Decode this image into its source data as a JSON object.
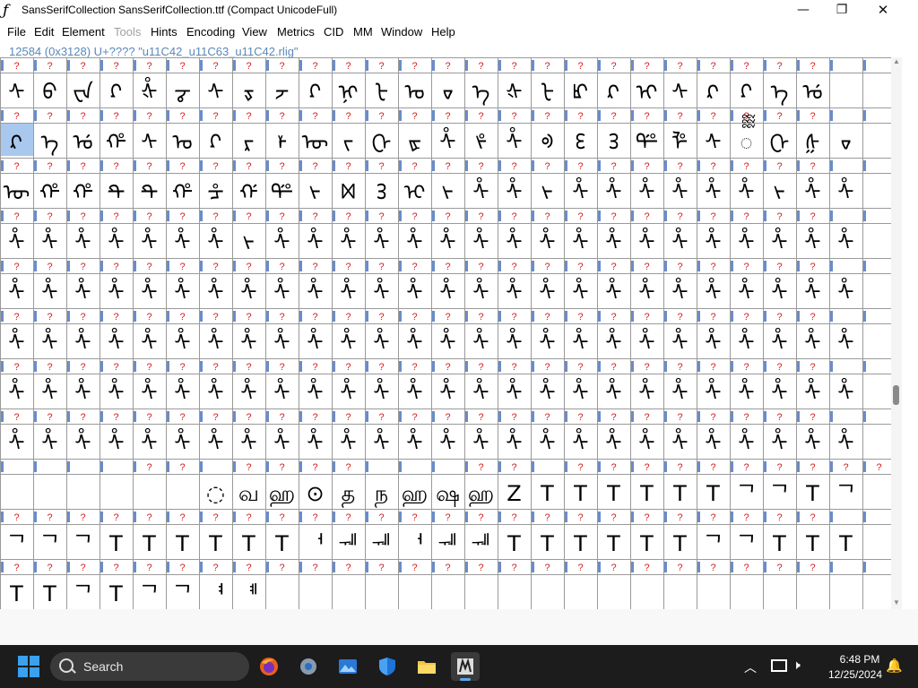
{
  "window": {
    "title": "SansSerifCollection  SansSerifCollection.ttf (Compact UnicodeFull)",
    "app_icon": "fontforge-icon",
    "controls": {
      "minimize": "—",
      "maximize": "❐",
      "close": "✕"
    }
  },
  "menu": [
    {
      "label": "File",
      "enabled": true
    },
    {
      "label": "Edit",
      "enabled": true
    },
    {
      "label": "Element",
      "enabled": true
    },
    {
      "label": "Tools",
      "enabled": false
    },
    {
      "label": "Hints",
      "enabled": true
    },
    {
      "label": "Encoding",
      "enabled": true
    },
    {
      "label": "View",
      "enabled": true
    },
    {
      "label": "Metrics",
      "enabled": true
    },
    {
      "label": "CID",
      "enabled": true
    },
    {
      "label": "MM",
      "enabled": true
    },
    {
      "label": "Window",
      "enabled": true
    },
    {
      "label": "Help",
      "enabled": true
    }
  ],
  "status_line": "12584 (0x3128) U+???? \"u11C42_u11C63_u11C42.rlig\"",
  "grid": {
    "columns": 27,
    "cell_label": "?",
    "row_label_colors": {
      "question": "#d42020",
      "unicode_box": "#4a4a4a",
      "marker": "#6a8cc8",
      "selected_bg": "#a8c8ee"
    },
    "rows": [
      {
        "labels": "?????????????????????????",
        "glyphs": [
          "ᠰ",
          "ᠪ",
          "ᠸᠠ",
          "ᡗ",
          "ᢤ",
          "ᡒ",
          "ᠰ",
          "ᢌ",
          "ᡔ",
          "ᡗ",
          "ᢊ",
          "ᡶ",
          "ᠣ",
          "ᢦ",
          "ᡝ",
          "ᡧ",
          "ᡶ",
          "ᡌ",
          "ᡘ",
          "ᡞ",
          "ᠰ",
          "ᡘ",
          "ᡗ",
          "ᡝ",
          "ᡠ",
          "",
          ""
        ]
      },
      {
        "labels": "?????????????????????????",
        "glyphs": [
          "ᡘ",
          "ᡝ",
          "ᡠ",
          "ᡥ",
          "ᠰ",
          "ᠣ",
          "ᡗ",
          "ᡵ",
          "ᡟ",
          "ᡡ",
          "ᡪ",
          "ᢕ",
          "ᢘ",
          "ᢥ",
          "ᢞ",
          "ᢥ",
          "ᢀ",
          "ᢄ",
          "ᢃ",
          "ᢡ",
          "ᢪ",
          "ᠰ",
          "ᢆ",
          "ᢕ",
          "ᢔ",
          "ᢦ",
          ""
        ]
      },
      {
        "labels": "?????????????????????????",
        "glyphs": [
          "ᡡ",
          "ᡥ",
          "ᡥ",
          "ᡨ",
          "ᡨ",
          "ᡥ",
          "ᡱ",
          "ᡤ",
          "ᢡ",
          "ᢣ",
          "ᢂ",
          "ᢃ",
          "ᢈ",
          "ᢣ",
          "ᢥ",
          "ᢥ",
          "ᢣ",
          "ᢥ",
          "ᢥ",
          "ᢥ",
          "ᢥ",
          "ᢥ",
          "ᢥ",
          "ᢣ",
          "ᢥ",
          "ᢥ",
          ""
        ]
      },
      {
        "labels": "?????????????????????????",
        "glyphs": [
          "ᢥ",
          "ᢥ",
          "ᢥ",
          "ᢥ",
          "ᢥ",
          "ᢥ",
          "ᢥ",
          "ᢣ",
          "ᢥ",
          "ᢥ",
          "ᢥ",
          "ᢥ",
          "ᢥ",
          "ᢥ",
          "ᢥ",
          "ᢥ",
          "ᢥ",
          "ᢥ",
          "ᢥ",
          "ᢥ",
          "ᢥ",
          "ᢥ",
          "ᢥ",
          "ᢥ",
          "ᢥ",
          "ᢥ",
          ""
        ]
      },
      {
        "labels": "?????????????????????????",
        "glyphs": [
          "ᢥ",
          "ᢥ",
          "ᢥ",
          "ᢥ",
          "ᢥ",
          "ᢥ",
          "ᢥ",
          "ᢥ",
          "ᢥ",
          "ᢥ",
          "ᢥ",
          "ᢥ",
          "ᢥ",
          "ᢥ",
          "ᢥ",
          "ᢥ",
          "ᢥ",
          "ᢥ",
          "ᢥ",
          "ᢥ",
          "ᢥ",
          "ᢥ",
          "ᢥ",
          "ᢥ",
          "ᢥ",
          "ᢥ",
          ""
        ]
      },
      {
        "labels": "?????????????????????????",
        "glyphs": [
          "ᢥ",
          "ᢥ",
          "ᢥ",
          "ᢥ",
          "ᢥ",
          "ᢥ",
          "ᢥ",
          "ᢥ",
          "ᢥ",
          "ᢥ",
          "ᢥ",
          "ᢥ",
          "ᢥ",
          "ᢥ",
          "ᢥ",
          "ᢥ",
          "ᢥ",
          "ᢥ",
          "ᢥ",
          "ᢥ",
          "ᢥ",
          "ᢥ",
          "ᢥ",
          "ᢥ",
          "ᢥ",
          "ᢥ",
          ""
        ]
      },
      {
        "labels": "?????????????????????????",
        "glyphs": [
          "ᢥ",
          "ᢥ",
          "ᢥ",
          "ᢥ",
          "ᢥ",
          "ᢥ",
          "ᢥ",
          "ᢥ",
          "ᢥ",
          "ᢥ",
          "ᢥ",
          "ᢥ",
          "ᢥ",
          "ᢥ",
          "ᢥ",
          "ᢥ",
          "ᢥ",
          "ᢥ",
          "ᢥ",
          "ᢥ",
          "ᢥ",
          "ᢥ",
          "ᢥ",
          "ᢥ",
          "ᢥ",
          "ᢥ",
          ""
        ]
      },
      {
        "labels": "?????????????????????????",
        "glyphs": [
          "ᢥ",
          "ᢥ",
          "ᢥ",
          "ᢥ",
          "ᢥ",
          "ᢥ",
          "ᢥ",
          "ᢥ",
          "ᢥ",
          "ᢥ",
          "ᢥ",
          "ᢥ",
          "ᢥ",
          "ᢥ",
          "ᢥ",
          "ᢥ",
          "ᢥ",
          "ᢥ",
          "ᢥ",
          "ᢥ",
          "ᢥ",
          "ᢥ",
          "ᢥ",
          "ᢥ",
          "ᢥ",
          "ᢥ",
          ""
        ]
      },
      {
        "labels": "    ?? ????   ?? ??????????",
        "glyphs": [
          "",
          "",
          "",
          "",
          "",
          "",
          "◌",
          "வ",
          "ஹ",
          "⊙",
          "த",
          "ந",
          "ஹ",
          "ஷ",
          "ஹ",
          "Z",
          "T",
          "T",
          "T",
          "T",
          "T",
          "T",
          "ᄀ",
          "ᄀ",
          "T",
          "ᄀ",
          ""
        ]
      },
      {
        "labels": "?????????????????????????",
        "glyphs": [
          "ᄀ",
          "ᄀ",
          "ᄀ",
          "T",
          "T",
          "T",
          "T",
          "T",
          "T",
          "ᅥ",
          "ᅰ",
          "ᅰ",
          "ᅥ",
          "ᅰ",
          "ᅰ",
          "T",
          "T",
          "T",
          "T",
          "T",
          "T",
          "ᄀ",
          "ᄀ",
          "T",
          "T",
          "T",
          ""
        ]
      },
      {
        "labels": "?????????????????????????",
        "glyphs": [
          "T",
          "T",
          "ᄀ",
          "T",
          "ᄀ",
          "ᄀ",
          "ᅧ",
          "ᅨ",
          "",
          "",
          "",
          "",
          "",
          "",
          "",
          "",
          "",
          "",
          "",
          "",
          "",
          "",
          "",
          "",
          "",
          "",
          ""
        ]
      }
    ]
  },
  "taskbar": {
    "search_label": "Search",
    "apps": [
      "firefox-icon",
      "settings-icon",
      "photos-icon",
      "security-icon",
      "file-explorer-icon",
      "fontforge-taskbar-icon"
    ],
    "clock_time": "6:48 PM",
    "clock_date": "12/25/2024"
  }
}
